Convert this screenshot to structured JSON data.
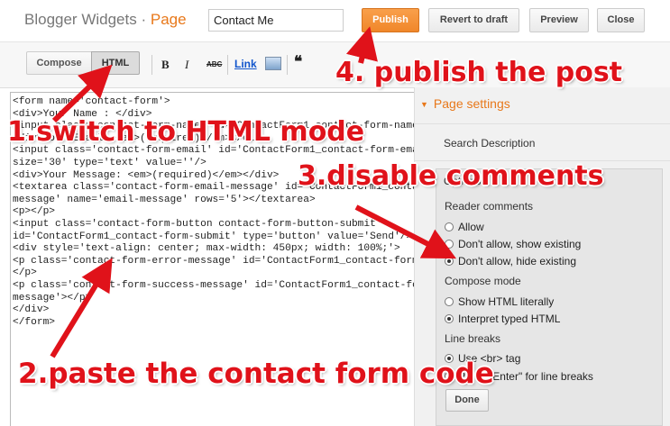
{
  "header": {
    "brand": "Blogger Widgets",
    "separator": "·",
    "section": "Page",
    "title_value": "Contact Me",
    "publish_label": "Publish",
    "revert_label": "Revert to draft",
    "preview_label": "Preview",
    "close_label": "Close"
  },
  "toolbar": {
    "compose_label": "Compose",
    "html_label": "HTML",
    "bold_glyph": "B",
    "italic_glyph": "I",
    "strike_glyph": "ABC",
    "link_label": "Link",
    "image_icon": "image-icon",
    "quote_glyph": "❝"
  },
  "editor": {
    "code": "<form name='contact-form'>\n<div>Your Name : </div>\n<input class='contact-form-name' id='ContactForm1_contact-form-name' name='name' size='30' type='text' value=''/>\n<div>Your Email: <em>(required)</em></div>\n<input class='contact-form-email' id='ContactForm1_contact-form-email' name='email'\nsize='30' type='text' value=''/>\n<div>Your Message: <em>(required)</em></div>\n<textarea class='contact-form-email-message' id='ContactForm1_contact-form-email-\nmessage' name='email-message' rows='5'></textarea>\n<p></p>\n<input class='contact-form-button contact-form-button-submit'\nid='ContactForm1_contact-form-submit' type='button' value='Send'/>\n<div style='text-align: center; max-width: 450px; width: 100%;'>\n<p class='contact-form-error-message' id='ContactForm1_contact-form-error-message'>\n</p>\n<p class='contact-form-success-message' id='ContactForm1_contact-form-success-\nmessage'></p>\n</div>\n</form>"
  },
  "sidebar": {
    "page_settings": "Page settings",
    "search_description": "Search Description",
    "options": "Options",
    "reader_comments": "Reader comments",
    "allow": "Allow",
    "dont_allow_show": "Don't allow, show existing",
    "dont_allow_hide": "Don't allow, hide existing",
    "compose_mode": "Compose mode",
    "show_html": "Show HTML literally",
    "interpret_html": "Interpret typed HTML",
    "line_breaks": "Line breaks",
    "use_br": "Use <br> tag",
    "press_enter": "Press \"Enter\" for line breaks",
    "done_label": "Done"
  },
  "annotations": {
    "step1": "1.switch to HTML mode",
    "step2": "2.paste the contact form code",
    "step3": "3.disable comments",
    "step4": "4. publish the post"
  },
  "colors": {
    "accent_orange": "#f0872a",
    "annotation_red": "#e0121a",
    "link_blue": "#1155cc"
  }
}
